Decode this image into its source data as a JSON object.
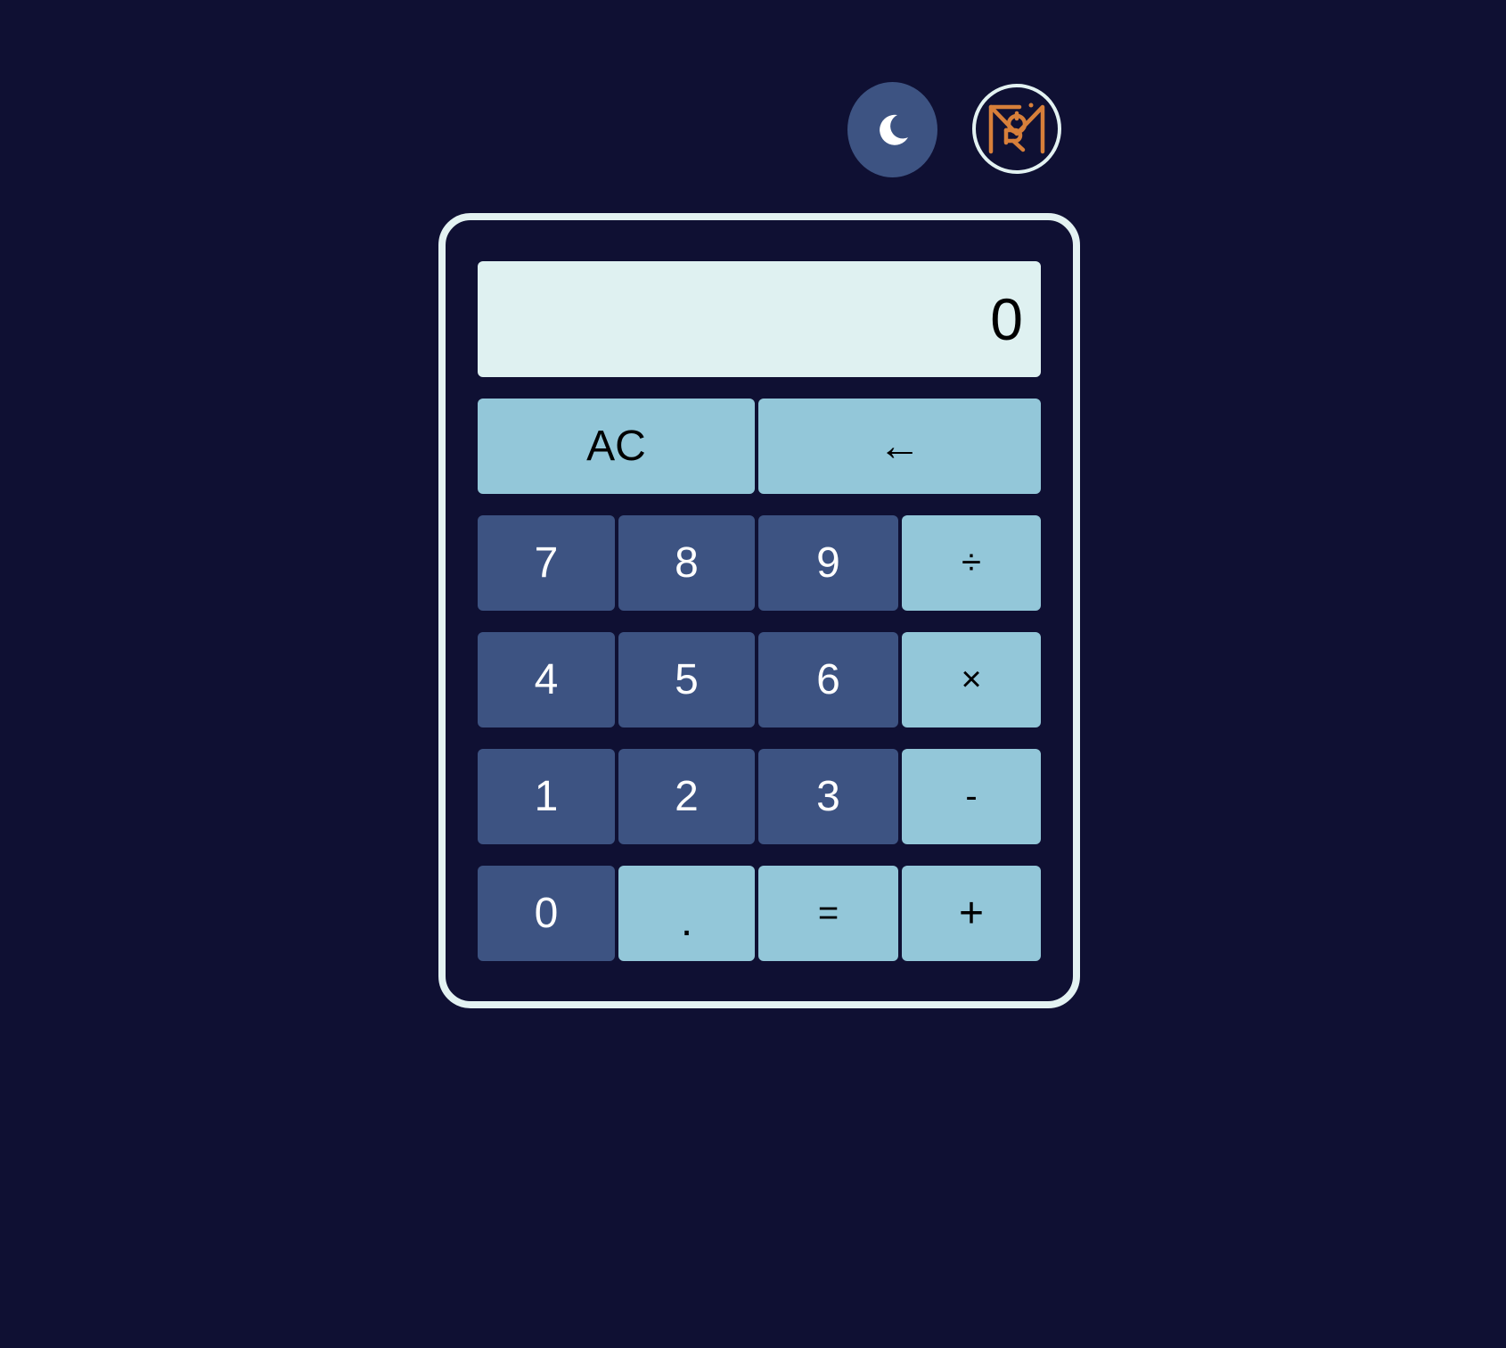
{
  "header": {
    "theme_toggle_icon": "moon-icon",
    "logo_icon": "monogram-logo-icon",
    "logo_color": "#d77f3a"
  },
  "display": {
    "value": "0"
  },
  "keys": {
    "clear": "AC",
    "backspace": "←",
    "seven": "7",
    "eight": "8",
    "nine": "9",
    "divide": "÷",
    "four": "4",
    "five": "5",
    "six": "6",
    "multiply": "×",
    "one": "1",
    "two": "2",
    "three": "3",
    "subtract": "-",
    "zero": "0",
    "decimal": ".",
    "equals": "=",
    "add": "+"
  },
  "colors": {
    "background": "#0f1033",
    "number_key": "#3d5382",
    "operator_key": "#93c7d9",
    "display": "#dff1f1",
    "frame": "#e3f2f2"
  }
}
